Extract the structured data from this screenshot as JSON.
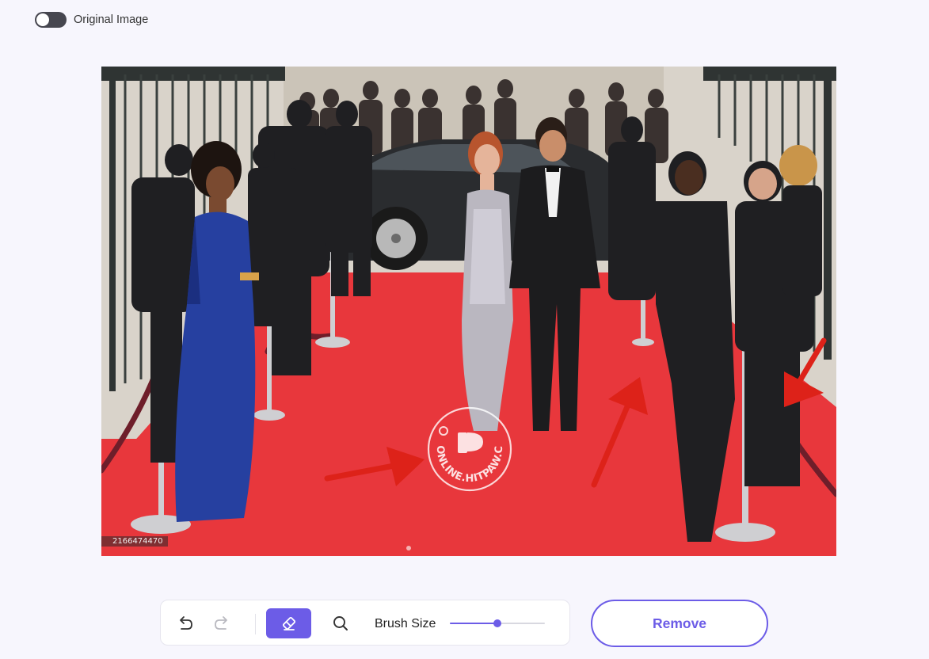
{
  "toggle": {
    "label": "Original Image",
    "state": "off"
  },
  "canvas": {
    "photo_id": "2166474470",
    "watermark_text": "ONLINE.HITPAW.C"
  },
  "toolbar": {
    "undo_icon": "undo-icon",
    "redo_icon": "redo-icon",
    "eraser_icon": "eraser-icon",
    "zoom_icon": "zoom-icon",
    "brush_size_label": "Brush Size",
    "brush_size_value": 0.5
  },
  "remove_button": {
    "label": "Remove"
  },
  "colors": {
    "accent": "#6c5ce7",
    "background": "#f7f6fd",
    "red_carpet": "#e8373c",
    "annotation_arrow": "#dd2219",
    "toggle_off": "#46464f"
  }
}
